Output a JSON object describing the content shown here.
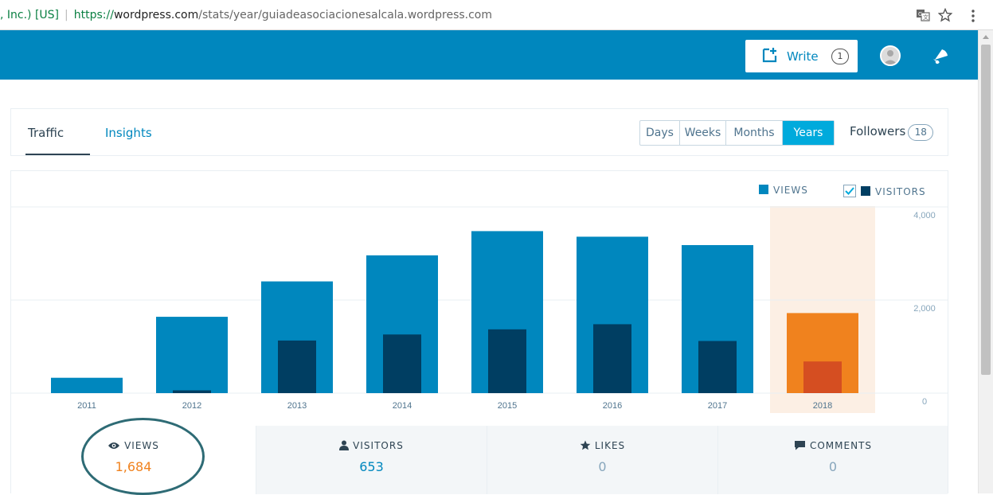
{
  "browser": {
    "cert_label": ", Inc.) [US]",
    "url_scheme": "https://",
    "url_domain": "wordpress.com",
    "url_path": "/stats/year/guiadeasociacionesalcala.wordpress.com",
    "icons": [
      "translate-icon",
      "star-icon",
      "menu-icon"
    ]
  },
  "masterbar": {
    "write_label": "Write",
    "write_count": "1",
    "colors": {
      "bar": "#0087be"
    }
  },
  "tabs": {
    "traffic": "Traffic",
    "insights": "Insights",
    "periods": [
      "Days",
      "Weeks",
      "Months",
      "Years"
    ],
    "active_period": "Years",
    "followers_label": "Followers",
    "followers_count": "18"
  },
  "legend": {
    "views": "VIEWS",
    "visitors": "VISITORS",
    "visitors_checked": true
  },
  "chart_data": {
    "type": "bar",
    "categories": [
      "2011",
      "2012",
      "2013",
      "2014",
      "2015",
      "2016",
      "2017",
      "2018"
    ],
    "series": [
      {
        "name": "VIEWS",
        "values": [
          330,
          1640,
          2400,
          2960,
          3480,
          3360,
          3180,
          1720
        ],
        "color": "#0087be"
      },
      {
        "name": "VISITORS",
        "values": [
          0,
          60,
          1130,
          1260,
          1370,
          1480,
          1120,
          680
        ],
        "color": "#003e62"
      }
    ],
    "highlight": {
      "category": "2018",
      "views_color": "#f0821e",
      "visitors_color": "#d54e21",
      "band_color": "#fcefe4"
    },
    "yticks": [
      "4,000",
      "2,000",
      "0"
    ],
    "ylim": [
      0,
      4000
    ],
    "grid": true
  },
  "stats": [
    {
      "label": "VIEWS",
      "value": "1,684",
      "icon": "eye-icon",
      "value_color": "#f0821e",
      "selected": true
    },
    {
      "label": "VISITORS",
      "value": "653",
      "icon": "person-icon",
      "value_color": "#0087be",
      "selected": false
    },
    {
      "label": "LIKES",
      "value": "0",
      "icon": "star-icon",
      "value_color": "#87a6bc",
      "selected": false
    },
    {
      "label": "COMMENTS",
      "value": "0",
      "icon": "comment-icon",
      "value_color": "#87a6bc",
      "selected": false
    }
  ]
}
